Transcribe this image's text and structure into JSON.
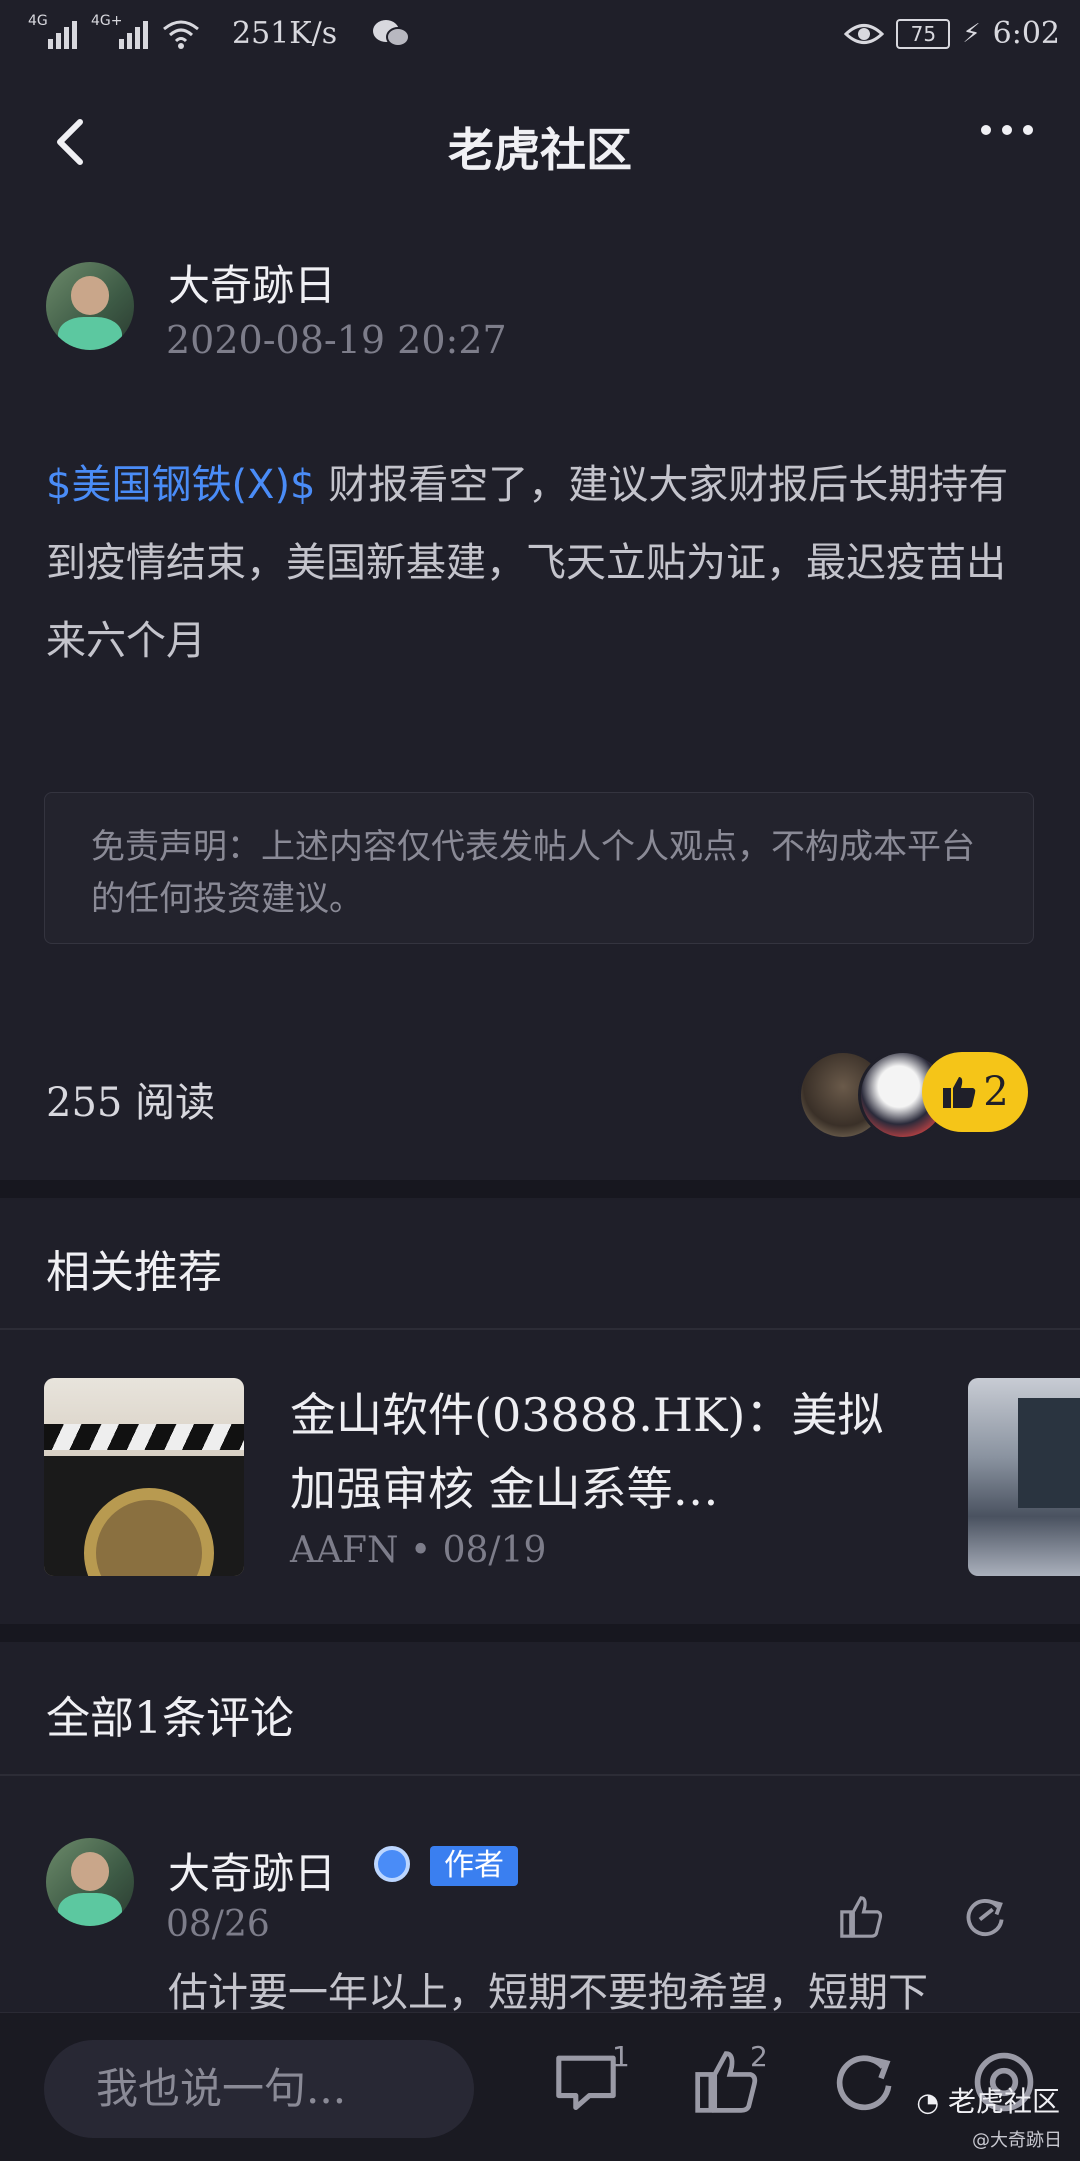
{
  "status_bar": {
    "network_1": "4G",
    "network_2": "4G+",
    "speed": "251K/s",
    "battery": "75",
    "time": "6:02"
  },
  "header": {
    "title": "老虎社区"
  },
  "post": {
    "author": "大奇跡日",
    "timestamp": "2020-08-19 20:27",
    "ticker": "$美国钢铁(X)$",
    "body": " 财报看空了，建议大家财报后长期持有到疫情结束，美国新基建，飞天立贴为证，最迟疫苗出来六个月",
    "disclaimer": "免责声明：上述内容仅代表发帖人个人观点，不构成本平台的任何投资建议。",
    "reads": "255 阅读",
    "like_count": "2"
  },
  "recommend": {
    "section_title": "相关推荐",
    "items": [
      {
        "title": "金山软件(03888.HK)：美拟加强审核 金山系等…",
        "source": "AAFN",
        "date": "08/19"
      }
    ]
  },
  "comments": {
    "section_title": "全部1条评论",
    "items": [
      {
        "author": "大奇跡日",
        "tag": "作者",
        "time": "08/26",
        "text": "估计要一年以上，短期不要抱希望，短期下"
      }
    ]
  },
  "bottom_bar": {
    "input_placeholder": "我也说一句...",
    "comment_count": "1",
    "like_count": "2"
  },
  "watermark": {
    "brand": "老虎社区",
    "user": "@大奇跡日"
  },
  "colors": {
    "background": "#1f1f29",
    "ticker_link": "#4a8cf7",
    "like_pill": "#f5c518",
    "author_tag": "#3a7ff0"
  }
}
